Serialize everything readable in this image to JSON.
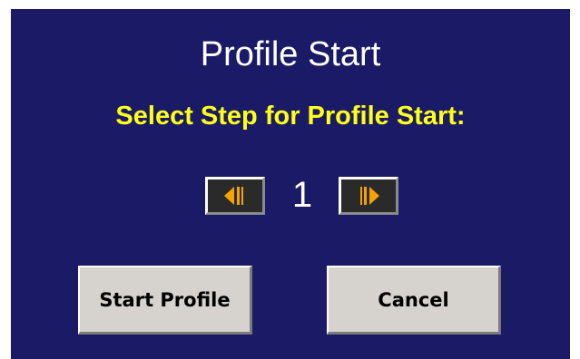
{
  "dialog": {
    "title": "Profile Start",
    "prompt": "Select Step for Profile Start:",
    "step_value": "1"
  },
  "stepper": {
    "prev_icon": "step-back-icon",
    "next_icon": "step-forward-icon"
  },
  "actions": {
    "start_label": "Start Profile",
    "cancel_label": "Cancel"
  },
  "colors": {
    "background": "#1a1a66",
    "prompt": "#ffff1a",
    "arrow": "#f5a300",
    "button_face": "#d6d3ce"
  }
}
